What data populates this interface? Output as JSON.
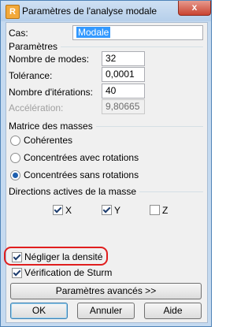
{
  "window": {
    "title": "Paramètres de l'analyse modale",
    "close_label": "x"
  },
  "cas": {
    "label": "Cas:",
    "value": "Modale"
  },
  "parametres": {
    "title": "Paramètres",
    "nb_modes": {
      "label": "Nombre de modes:",
      "value": "32"
    },
    "tolerance": {
      "label": "Tolérance:",
      "value": "0,0001"
    },
    "nb_iterations": {
      "label": "Nombre d'itérations:",
      "value": "40"
    },
    "acceleration": {
      "label": "Accélération:",
      "value": "9,80665"
    }
  },
  "matrice": {
    "title": "Matrice des masses",
    "options": [
      "Cohérentes",
      "Concentrées avec rotations",
      "Concentrées sans rotations"
    ],
    "selected": "Concentrées sans rotations"
  },
  "directions": {
    "title": "Directions actives de la masse",
    "x": {
      "label": "X",
      "checked": true
    },
    "y": {
      "label": "Y",
      "checked": true
    },
    "z": {
      "label": "Z",
      "checked": false
    }
  },
  "negliger_densite": {
    "label": "Négliger la densité",
    "checked": true
  },
  "verif_sturm": {
    "label": "Vérification de Sturm",
    "checked": true
  },
  "buttons": {
    "advanced": "Paramètres avancés >>",
    "ok": "OK",
    "cancel": "Annuler",
    "help": "Aide"
  },
  "colors": {
    "highlight": "#e01e1e",
    "selection": "#3399ff",
    "titlebar": "#c5daf0"
  }
}
